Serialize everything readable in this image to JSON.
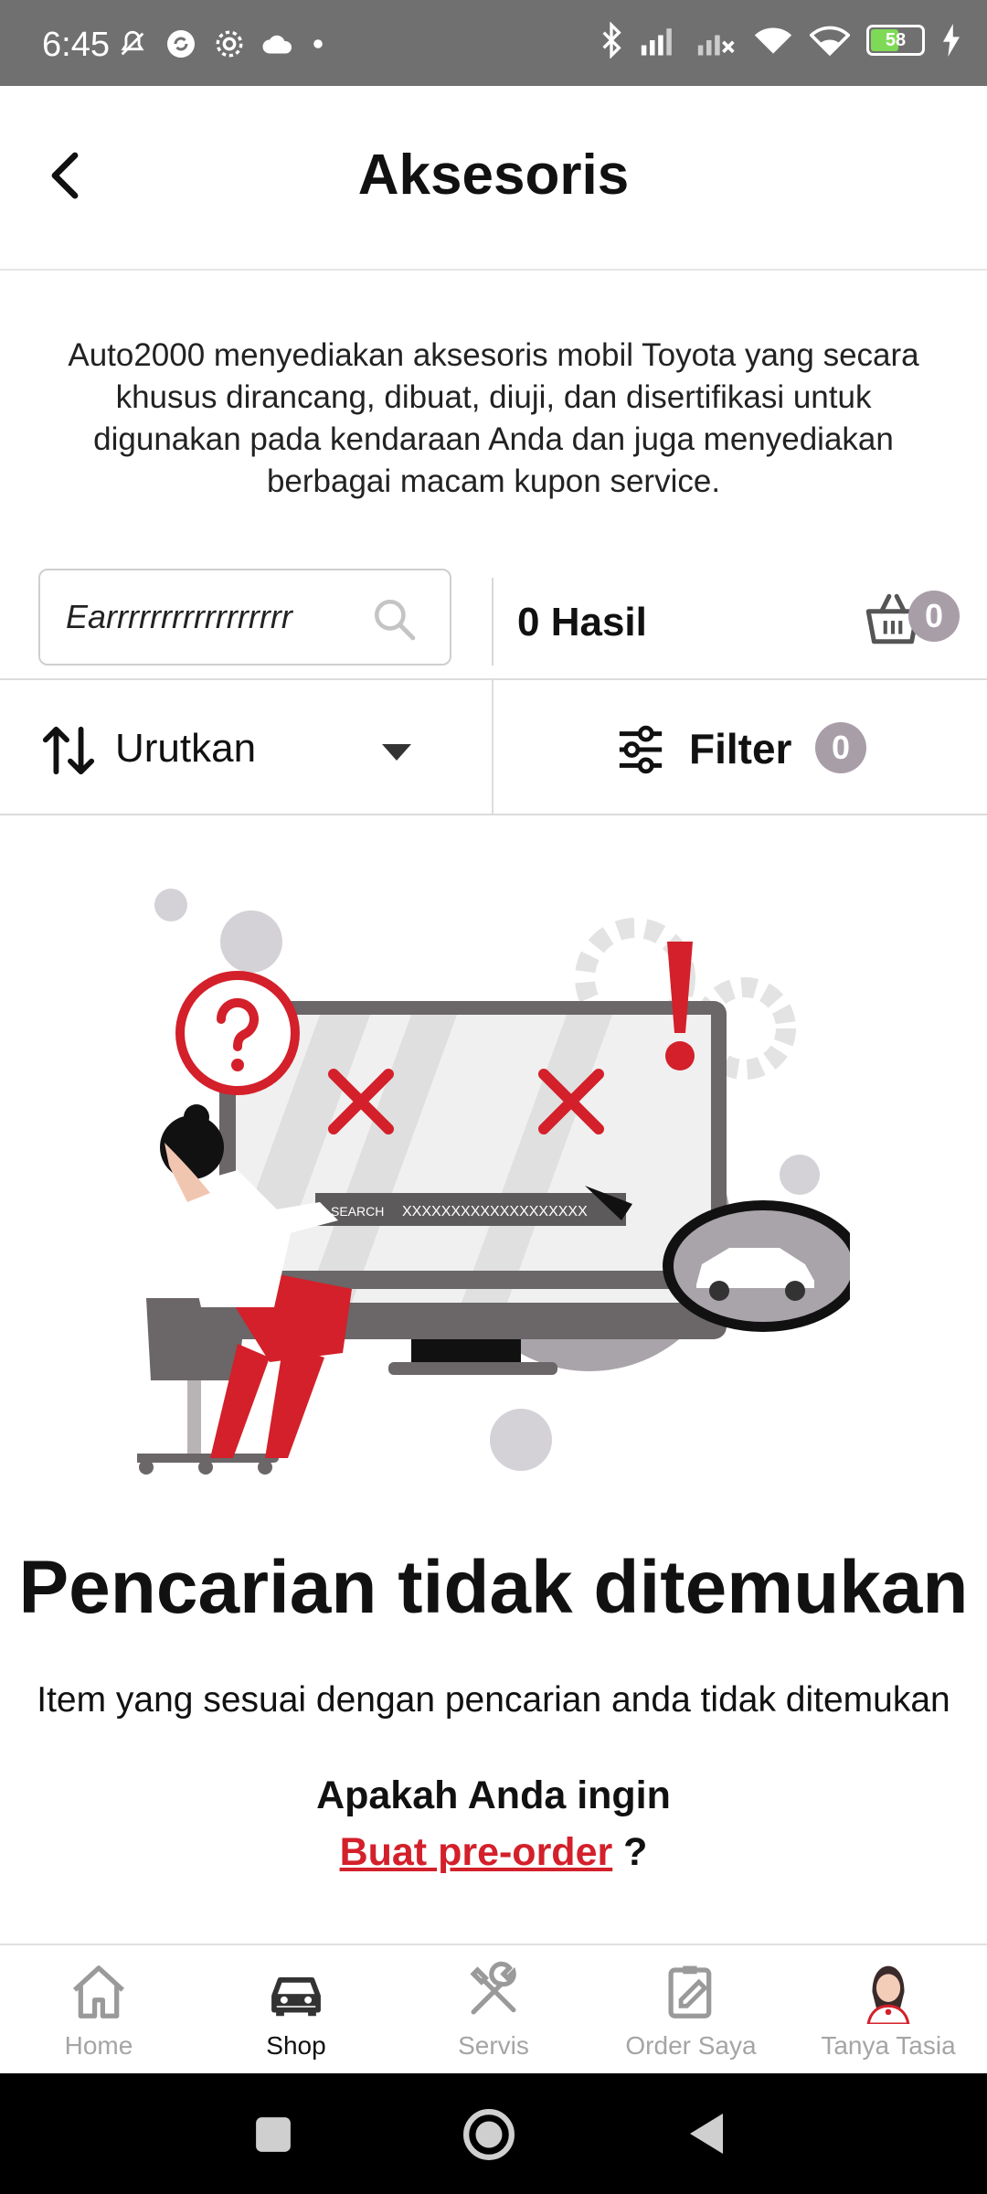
{
  "status_bar": {
    "time": "6:45",
    "battery": "58",
    "icons_left": [
      "muted-bell-icon",
      "sync-icon",
      "settings-icon",
      "cloud-icon",
      "dot-icon"
    ],
    "icons_right": [
      "bluetooth-icon",
      "signal-icon",
      "signal-off-icon",
      "wifi-icon",
      "wifi-icon",
      "battery-icon",
      "charging-icon"
    ]
  },
  "header": {
    "title": "Aksesoris"
  },
  "intro": {
    "text": "Auto2000 menyediakan aksesoris mobil Toyota yang secara khusus dirancang, dibuat, diuji, dan disertifikasi untuk digunakan pada kendaraan Anda dan juga menyediakan berbagai macam kupon service."
  },
  "search": {
    "value": "Earrrrrrrrrrrrrrrrr",
    "results": "0 Hasil",
    "cart_count": "0"
  },
  "sort_filter": {
    "sort_label": "Urutkan",
    "filter_label": "Filter",
    "filter_count": "0"
  },
  "illustration": {
    "search_label": "SEARCH",
    "search_text": "XXXXXXXXXXXXXXXXXXX"
  },
  "empty_state": {
    "title": "Pencarian tidak ditemukan",
    "description": "Item yang sesuai dengan pencarian anda tidak ditemukan",
    "question": "Apakah Anda ingin",
    "preorder_link": "Buat pre-order",
    "preorder_suffix": " ?"
  },
  "bottom_nav": {
    "items": [
      {
        "label": "Home",
        "icon": "home-icon"
      },
      {
        "label": "Shop",
        "icon": "car-icon",
        "active": true
      },
      {
        "label": "Servis",
        "icon": "tools-icon"
      },
      {
        "label": "Order Saya",
        "icon": "order-icon"
      },
      {
        "label": "Tanya Tasia",
        "icon": "assistant-avatar"
      }
    ]
  },
  "colors": {
    "brand_red": "#d3202a",
    "badge_grey": "#a89ea8",
    "status_bar": "#707070"
  }
}
